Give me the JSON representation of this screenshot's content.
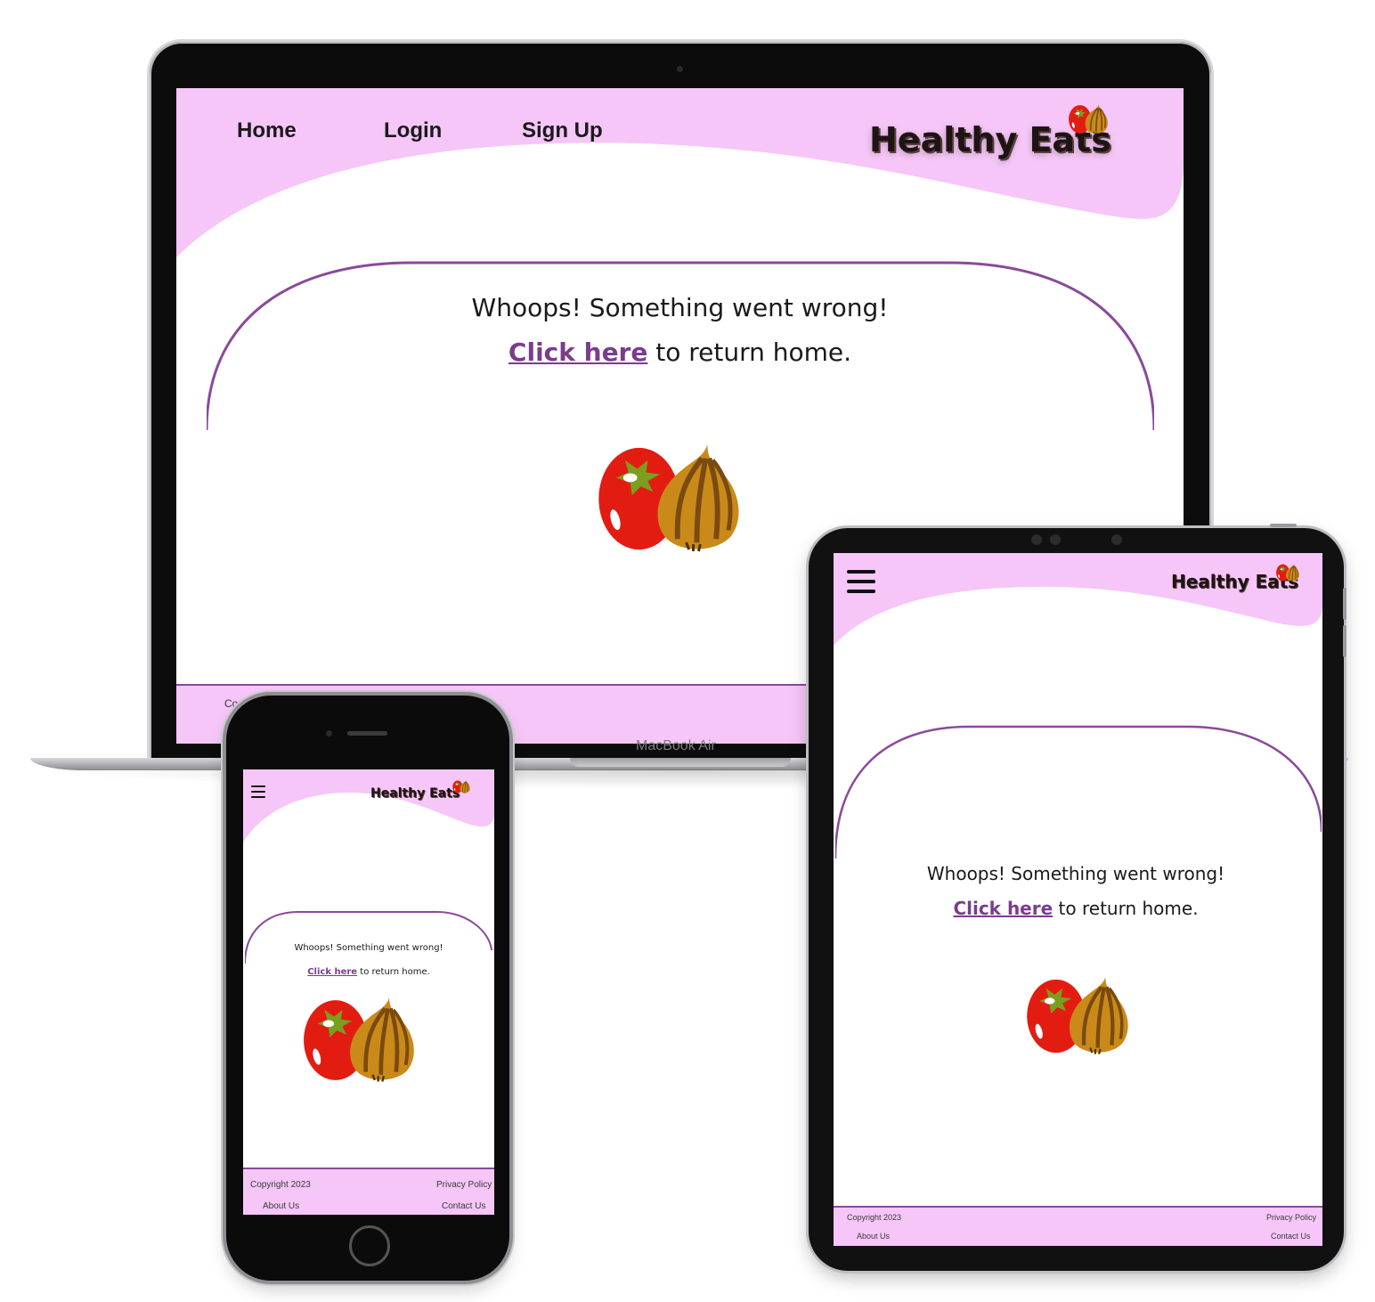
{
  "site": {
    "logo_text": "Healthy Eats",
    "nav": {
      "home": "Home",
      "login": "Login",
      "signup": "Sign Up"
    },
    "error": {
      "line1": "Whoops! Something went wrong!",
      "link": "Click here",
      "line2_rest": " to return home."
    },
    "footer": {
      "copyright": "Copyright 2023",
      "copyright_partial": "Cop",
      "privacy": "Privacy Policy",
      "about": "About Us",
      "contact": "Contact Us"
    }
  },
  "device": {
    "laptop_label": "MacBook Air"
  },
  "colors": {
    "header_pink": "#f5c6f7",
    "accent_purple": "#8a4a9a",
    "link_purple": "#7a3d8c",
    "tomato_red": "#e31c12",
    "onion_gold": "#c98a1a"
  }
}
